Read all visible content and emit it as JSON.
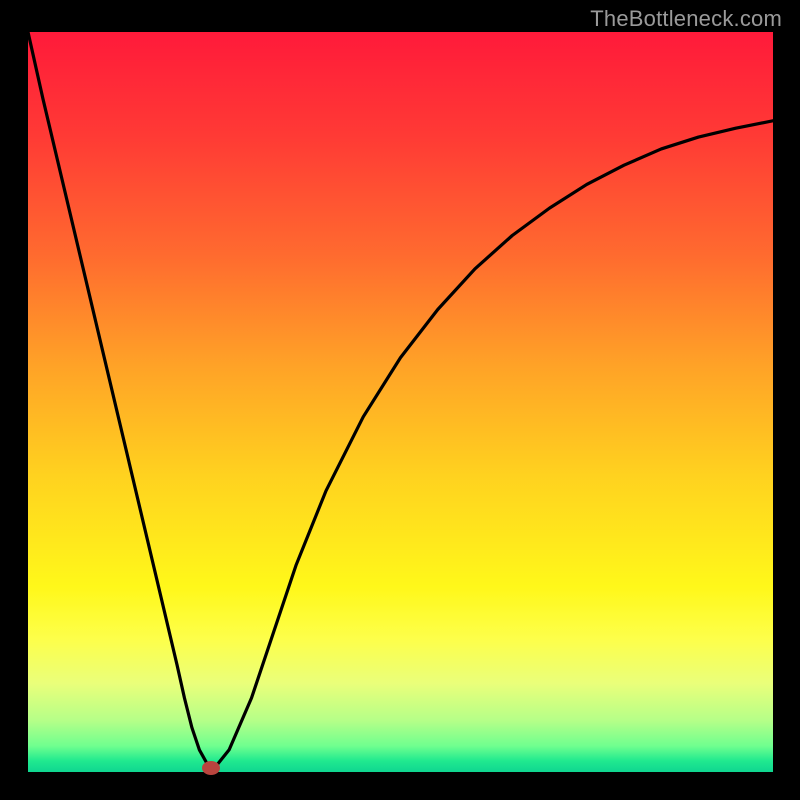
{
  "watermark": "TheBottleneck.com",
  "chart_data": {
    "type": "line",
    "title": "",
    "xlabel": "",
    "ylabel": "",
    "xlim": [
      0,
      100
    ],
    "ylim": [
      0,
      100
    ],
    "gradient_stops": [
      {
        "offset": 0.0,
        "color": "#ff1a3a"
      },
      {
        "offset": 0.14,
        "color": "#ff3a35"
      },
      {
        "offset": 0.3,
        "color": "#ff6a2f"
      },
      {
        "offset": 0.45,
        "color": "#ffa227"
      },
      {
        "offset": 0.6,
        "color": "#ffd21f"
      },
      {
        "offset": 0.75,
        "color": "#fff81a"
      },
      {
        "offset": 0.82,
        "color": "#fdff4a"
      },
      {
        "offset": 0.88,
        "color": "#eaff7a"
      },
      {
        "offset": 0.93,
        "color": "#b6ff88"
      },
      {
        "offset": 0.965,
        "color": "#6fff8f"
      },
      {
        "offset": 0.985,
        "color": "#20e98f"
      },
      {
        "offset": 1.0,
        "color": "#0fd690"
      }
    ],
    "series": [
      {
        "name": "bottleneck-curve",
        "x": [
          0,
          2,
          4,
          6,
          8,
          10,
          12,
          14,
          16,
          18,
          20,
          21,
          22,
          23,
          24,
          25,
          27,
          30,
          33,
          36,
          40,
          45,
          50,
          55,
          60,
          65,
          70,
          75,
          80,
          85,
          90,
          95,
          100
        ],
        "y": [
          100,
          91,
          82.5,
          74,
          65.5,
          57,
          48.5,
          40,
          31.5,
          23,
          14.5,
          10,
          6,
          3,
          1.2,
          0.5,
          3,
          10,
          19,
          28,
          38,
          48,
          56,
          62.5,
          68,
          72.5,
          76.2,
          79.4,
          82,
          84.2,
          85.8,
          87,
          88
        ]
      }
    ],
    "marker": {
      "x": 24.5,
      "y": 0.5,
      "color": "#b9443e"
    },
    "annotations": []
  }
}
